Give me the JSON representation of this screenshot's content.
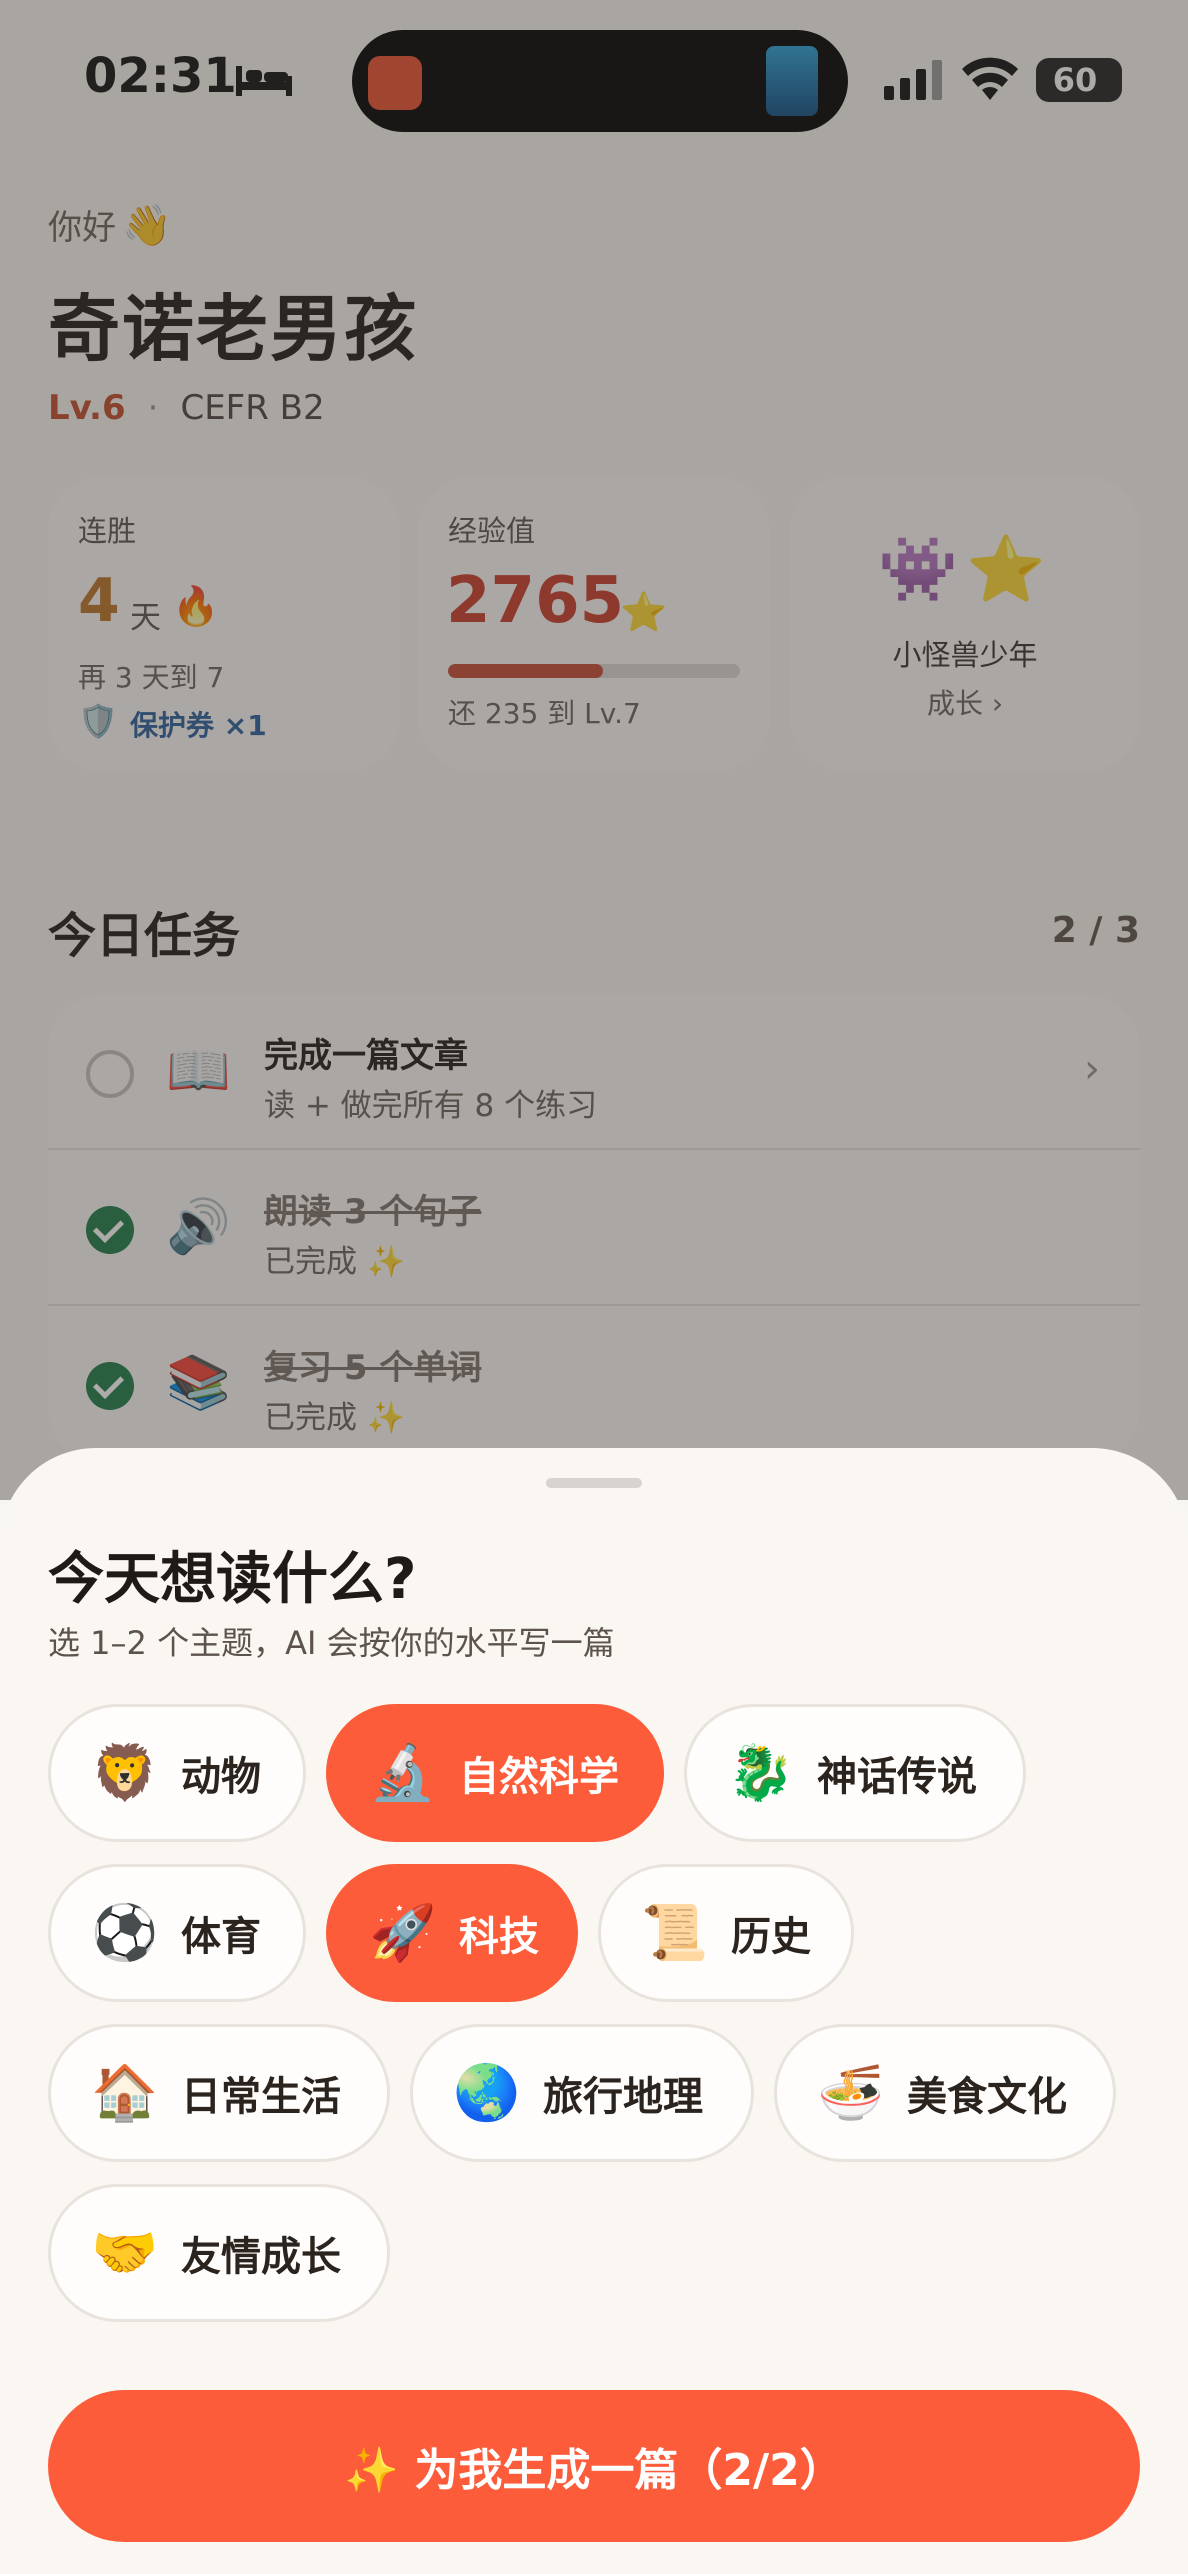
{
  "status": {
    "time": "02:31",
    "battery": "60"
  },
  "header": {
    "greeting": "你好",
    "greeting_icon": "👋",
    "name": "奇诺老男孩",
    "level": "Lv.6",
    "separator": "·",
    "cefr": "CEFR B2"
  },
  "stats": {
    "streak": {
      "label": "连胜",
      "value": "4",
      "unit": "天",
      "icon": "🔥",
      "sub": "再 3 天到 7",
      "shield_icon": "🛡️",
      "protect": "保护券 ×1"
    },
    "xp": {
      "label": "经验值",
      "value": "2765",
      "icon": "⭐",
      "progress": 0.53,
      "sub": "还 235 到 Lv.7"
    },
    "badge": {
      "icons": [
        "👾",
        "⭐"
      ],
      "title": "小怪兽少年",
      "link": "成长 ›"
    }
  },
  "tasks": {
    "title": "今日任务",
    "count": "2 / 3",
    "items": [
      {
        "icon": "📖",
        "title": "完成一篇文章",
        "sub": "读 + 做完所有 8 个练习",
        "done": false,
        "chevron": "›"
      },
      {
        "icon": "🔊",
        "title": "朗读 3 个句子",
        "sub": "已完成 ✨",
        "done": true
      },
      {
        "icon": "📚",
        "title": "复习 5 个单词",
        "sub": "已完成 ✨",
        "done": true
      }
    ]
  },
  "sheet": {
    "title": "今天想读什么?",
    "subtitle": "选 1–2 个主题，AI 会按你的水平写一篇",
    "topics": [
      {
        "icon": "🦁",
        "label": "动物",
        "selected": false
      },
      {
        "icon": "🔬",
        "label": "自然科学",
        "selected": true
      },
      {
        "icon": "🐉",
        "label": "神话传说",
        "selected": false
      },
      {
        "icon": "⚽",
        "label": "体育",
        "selected": false
      },
      {
        "icon": "🚀",
        "label": "科技",
        "selected": true
      },
      {
        "icon": "📜",
        "label": "历史",
        "selected": false
      },
      {
        "icon": "🏠",
        "label": "日常生活",
        "selected": false
      },
      {
        "icon": "🌏",
        "label": "旅行地理",
        "selected": false
      },
      {
        "icon": "🍜",
        "label": "美食文化",
        "selected": false
      },
      {
        "icon": "🤝",
        "label": "友情成长",
        "selected": false
      }
    ],
    "cta": "✨ 为我生成一篇（2/2）"
  },
  "colors": {
    "accent": "#fc5c39",
    "level": "#c24a2c",
    "success": "#1d7a49"
  }
}
